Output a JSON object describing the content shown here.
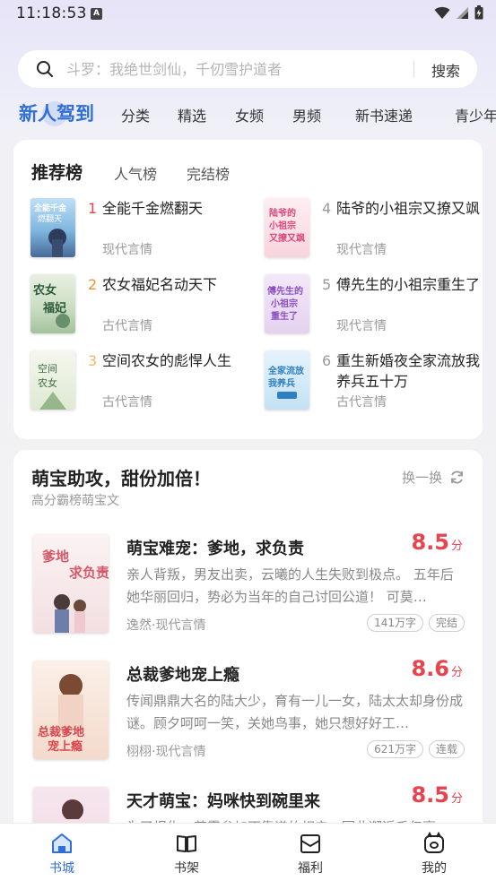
{
  "status": {
    "time": "11:18:53",
    "notif": "A"
  },
  "search": {
    "placeholder": "斗罗：我绝世剑仙，千仞雪护道者",
    "button": "搜索"
  },
  "top_tabs": [
    "新人驾到",
    "分类",
    "精选",
    "女频",
    "男频",
    "新书速递",
    "青少年"
  ],
  "ranking": {
    "tabs": [
      "推荐榜",
      "人气榜",
      "完结榜"
    ],
    "items": [
      {
        "num": "1",
        "title": "全能千金燃翻天",
        "genre": "现代言情",
        "num_color": "#e8434f",
        "cover_text": "全能千金燃翻天"
      },
      {
        "num": "2",
        "title": "农女福妃名动天下",
        "genre": "古代言情",
        "num_color": "#f0902e",
        "cover_text": "农女福妃"
      },
      {
        "num": "3",
        "title": "空间农女的彪悍人生",
        "genre": "古代言情",
        "num_color": "#f4b86a",
        "cover_text": "空间农女"
      },
      {
        "num": "4",
        "title": "陆爷的小祖宗又撩又飒",
        "genre": "现代言情",
        "num_color": "#9a9a9a",
        "cover_text": "陆爷的小祖宗又撩又飒"
      },
      {
        "num": "5",
        "title": "傅先生的小祖宗重生了",
        "genre": "现代言情",
        "num_color": "#9a9a9a",
        "cover_text": "傅先生的小祖宗重生了"
      },
      {
        "num": "6",
        "title": "重生新婚夜全家流放我养兵五十万",
        "genre": "古代言情",
        "num_color": "#9a9a9a",
        "cover_text": "全家流放我养兵"
      }
    ]
  },
  "section": {
    "title": "萌宝助攻，甜份加倍！",
    "subtitle": "高分霸榜萌宝文",
    "refresh": "换一换",
    "books": [
      {
        "title": "萌宝难宠：爹地，求负责",
        "score": "8.5",
        "score_unit": "分",
        "desc": "亲人背叛，男友出卖，云曦的人生失败到极点。 五年后她华丽回归，势必为当年的自己讨回公道！ 可莫…",
        "author": "逸然·现代言情",
        "words": "141万字",
        "status": "完结",
        "cover_text": "爹地求负责"
      },
      {
        "title": "总裁爹地宠上瘾",
        "score": "8.6",
        "score_unit": "分",
        "desc": "传闻鼎鼎大名的陆大少，育有一儿一女，陆太太却身份成谜。顾夕呵呵一笑，关她鸟事，她只想好好工…",
        "author": "栩栩·现代言情",
        "words": "621万字",
        "status": "连载",
        "cover_text": "总裁爹地宠上瘾"
      },
      {
        "title": "天才萌宝：妈咪快到碗里来",
        "score": "8.5",
        "score_unit": "分",
        "desc": "为了报仇，苏雾参加不靠谱的相亲，因此邂逅千亿豪…",
        "author": "",
        "words": "",
        "status": "",
        "cover_text": ""
      }
    ]
  },
  "bottom_nav": [
    "书城",
    "书架",
    "福利",
    "我的"
  ]
}
